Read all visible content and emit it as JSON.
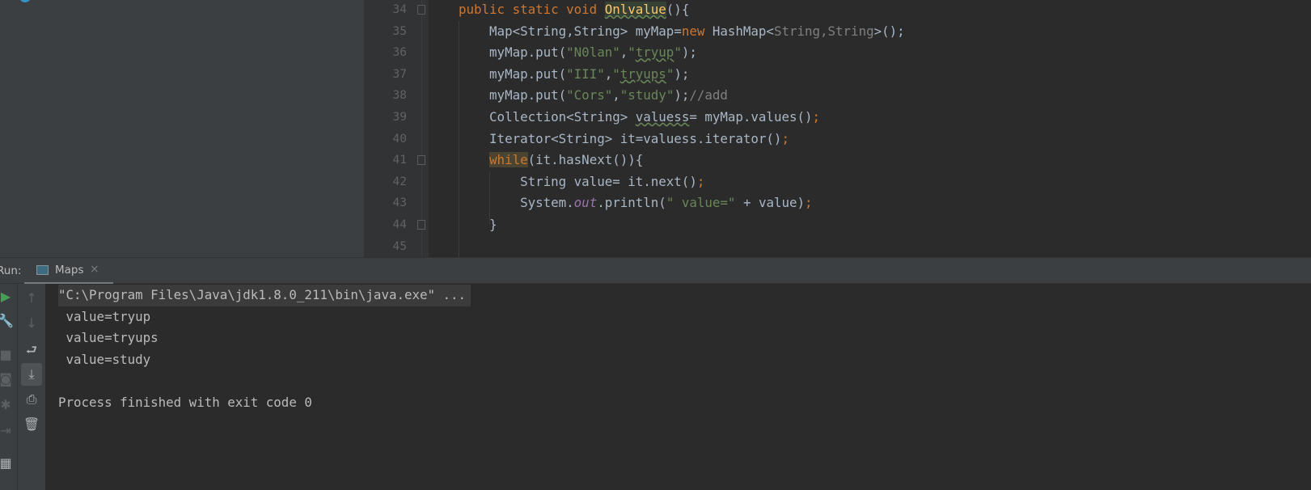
{
  "editor": {
    "line_numbers": [
      "34",
      "35",
      "36",
      "37",
      "38",
      "39",
      "40",
      "41",
      "42",
      "43",
      "44",
      "45"
    ],
    "lines": [
      [
        [
          "public static void ",
          "kw"
        ],
        [
          "Onlvalue",
          "fn"
        ],
        [
          "(){",
          ""
        ]
      ],
      [
        [
          "    Map<String,String> myMap=",
          ""
        ],
        [
          "new ",
          "kw"
        ],
        [
          "HashMap<",
          ""
        ],
        [
          "String,String",
          "gen"
        ],
        [
          ">();",
          ""
        ]
      ],
      [
        [
          "    myMap.put(",
          ""
        ],
        [
          "\"N0lan\"",
          "str"
        ],
        [
          ",",
          ""
        ],
        [
          "\"",
          "str"
        ],
        [
          "tryup",
          "str warn"
        ],
        [
          "\"",
          "str"
        ],
        [
          ");",
          ""
        ]
      ],
      [
        [
          "    myMap.put(",
          ""
        ],
        [
          "\"III\"",
          "str"
        ],
        [
          ",",
          ""
        ],
        [
          "\"",
          "str"
        ],
        [
          "tryups",
          "str warn"
        ],
        [
          "\"",
          "str"
        ],
        [
          ");",
          ""
        ]
      ],
      [
        [
          "    myMap.put(",
          ""
        ],
        [
          "\"Cors\"",
          "str"
        ],
        [
          ",",
          ""
        ],
        [
          "\"study\"",
          "str"
        ],
        [
          ");",
          ""
        ],
        [
          "//add",
          "cmt"
        ]
      ],
      [
        [
          "    Collection<String> ",
          ""
        ],
        [
          "valuess",
          "warn"
        ],
        [
          "= myMap.values()",
          ""
        ],
        [
          ";",
          "kw"
        ]
      ],
      [
        [
          "    Iterator<String> it=valuess.iterator()",
          ""
        ],
        [
          ";",
          "kw"
        ]
      ],
      [
        [
          "    ",
          ""
        ],
        [
          "while",
          "kw hl"
        ],
        [
          "(it.hasNext()){",
          ""
        ]
      ],
      [
        [
          "        String value= it.next()",
          ""
        ],
        [
          ";",
          "kw"
        ]
      ],
      [
        [
          "        System.",
          ""
        ],
        [
          "out",
          "fld"
        ],
        [
          ".println(",
          ""
        ],
        [
          "\" value=\"",
          "str"
        ],
        [
          " + value)",
          ""
        ],
        [
          ";",
          "kw"
        ]
      ],
      [
        [
          "    }",
          ""
        ]
      ],
      [
        [
          "",
          ""
        ]
      ]
    ]
  },
  "run": {
    "label": "Run:",
    "tab": "Maps",
    "close": "×"
  },
  "console": {
    "command": "\"C:\\Program Files\\Java\\jdk1.8.0_211\\bin\\java.exe\" ...",
    "output": [
      " value=tryup",
      " value=tryups",
      " value=study"
    ],
    "exit": "Process finished with exit code 0"
  }
}
